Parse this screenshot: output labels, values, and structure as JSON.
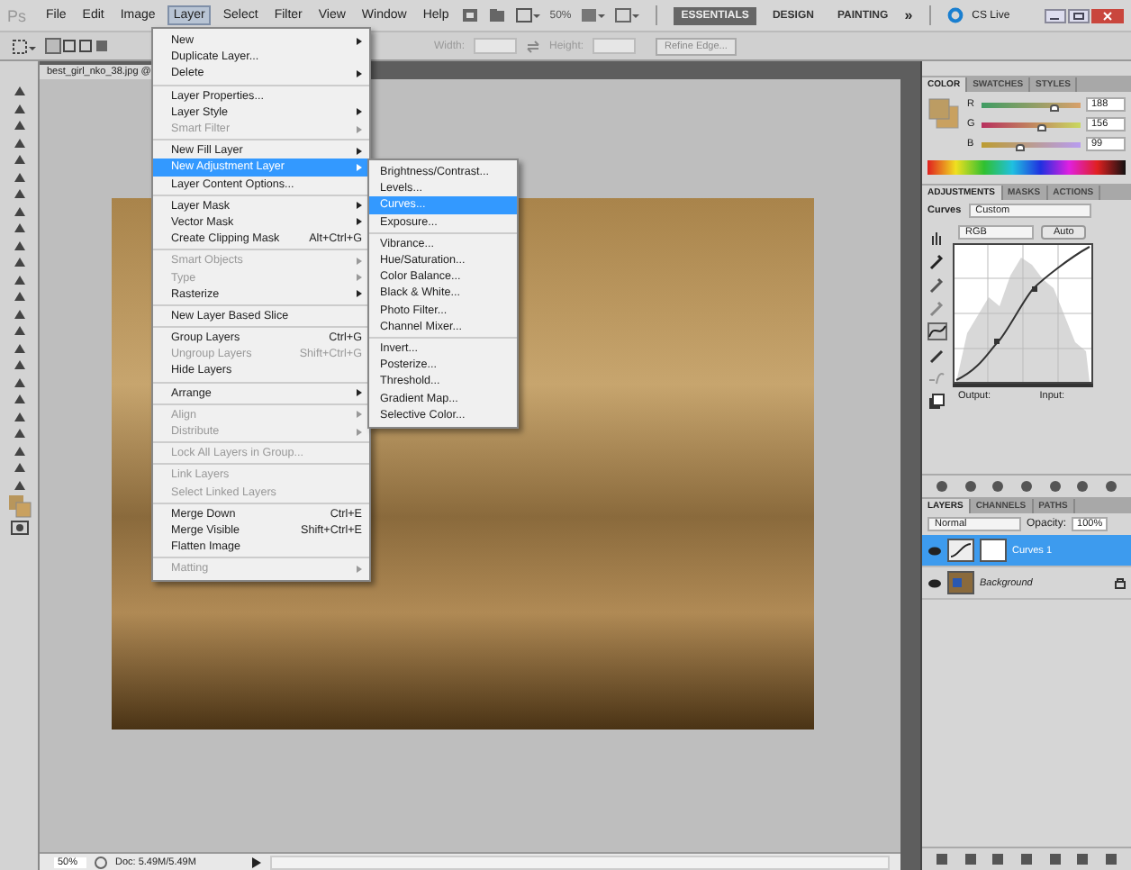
{
  "menu_bar": {
    "logo": "Ps",
    "items": [
      {
        "label": "File",
        "selected": false
      },
      {
        "label": "Edit",
        "selected": false
      },
      {
        "label": "Image",
        "selected": false
      },
      {
        "label": "Layer",
        "selected": true
      },
      {
        "label": "Select",
        "selected": false
      },
      {
        "label": "Filter",
        "selected": false
      },
      {
        "label": "View",
        "selected": false
      },
      {
        "label": "Window",
        "selected": false
      },
      {
        "label": "Help",
        "selected": false
      }
    ],
    "zoom": "50%",
    "workspaces": [
      {
        "label": "ESSENTIALS",
        "selected": true
      },
      {
        "label": "DESIGN",
        "selected": false
      },
      {
        "label": "PAINTING",
        "selected": false
      }
    ],
    "more": "»",
    "cs_live": "CS Live"
  },
  "options_bar": {
    "width_label": "Width:",
    "height_label": "Height:",
    "refine_button": "Refine Edge..."
  },
  "document_tab": {
    "title": "best_girl_nko_38.jpg @"
  },
  "layer_menu": {
    "groups": [
      [
        {
          "label": "New",
          "disabled": false,
          "submenu": true,
          "selected": false
        },
        {
          "label": "Duplicate Layer...",
          "disabled": false,
          "submenu": false,
          "selected": false
        },
        {
          "label": "Delete",
          "disabled": false,
          "submenu": true,
          "selected": false
        }
      ],
      [
        {
          "label": "Layer Properties...",
          "disabled": false,
          "submenu": false,
          "selected": false
        },
        {
          "label": "Layer Style",
          "disabled": false,
          "submenu": true,
          "selected": false
        },
        {
          "label": "Smart Filter",
          "disabled": true,
          "submenu": true,
          "selected": false
        }
      ],
      [
        {
          "label": "New Fill Layer",
          "disabled": false,
          "submenu": true,
          "selected": false
        },
        {
          "label": "New Adjustment Layer",
          "disabled": false,
          "submenu": true,
          "selected": true
        },
        {
          "label": "Layer Content Options...",
          "disabled": false,
          "submenu": false,
          "selected": false
        }
      ],
      [
        {
          "label": "Layer Mask",
          "disabled": false,
          "submenu": true,
          "selected": false
        },
        {
          "label": "Vector Mask",
          "disabled": false,
          "submenu": true,
          "selected": false
        },
        {
          "label": "Create Clipping Mask",
          "shortcut": "Alt+Ctrl+G",
          "disabled": false,
          "submenu": false,
          "selected": false
        }
      ],
      [
        {
          "label": "Smart Objects",
          "disabled": true,
          "submenu": true,
          "selected": false
        },
        {
          "label": "Type",
          "disabled": true,
          "submenu": true,
          "selected": false
        },
        {
          "label": "Rasterize",
          "disabled": false,
          "submenu": true,
          "selected": false
        }
      ],
      [
        {
          "label": "New Layer Based Slice",
          "disabled": false,
          "submenu": false,
          "selected": false
        }
      ],
      [
        {
          "label": "Group Layers",
          "shortcut": "Ctrl+G",
          "disabled": false,
          "submenu": false,
          "selected": false
        },
        {
          "label": "Ungroup Layers",
          "shortcut": "Shift+Ctrl+G",
          "disabled": true,
          "submenu": false,
          "selected": false
        },
        {
          "label": "Hide Layers",
          "disabled": false,
          "submenu": false,
          "selected": false
        }
      ],
      [
        {
          "label": "Arrange",
          "disabled": false,
          "submenu": true,
          "selected": false
        }
      ],
      [
        {
          "label": "Align",
          "disabled": true,
          "submenu": true,
          "selected": false
        },
        {
          "label": "Distribute",
          "disabled": true,
          "submenu": true,
          "selected": false
        }
      ],
      [
        {
          "label": "Lock All Layers in Group...",
          "disabled": true,
          "submenu": false,
          "selected": false
        }
      ],
      [
        {
          "label": "Link Layers",
          "disabled": true,
          "submenu": false,
          "selected": false
        },
        {
          "label": "Select Linked Layers",
          "disabled": true,
          "submenu": false,
          "selected": false
        }
      ],
      [
        {
          "label": "Merge Down",
          "shortcut": "Ctrl+E",
          "disabled": false,
          "submenu": false,
          "selected": false
        },
        {
          "label": "Merge Visible",
          "shortcut": "Shift+Ctrl+E",
          "disabled": false,
          "submenu": false,
          "selected": false
        },
        {
          "label": "Flatten Image",
          "disabled": false,
          "submenu": false,
          "selected": false
        }
      ],
      [
        {
          "label": "Matting",
          "disabled": true,
          "submenu": true,
          "selected": false
        }
      ]
    ]
  },
  "adjustment_submenu": {
    "groups": [
      [
        {
          "label": "Brightness/Contrast...",
          "selected": false
        },
        {
          "label": "Levels...",
          "selected": false
        },
        {
          "label": "Curves...",
          "selected": true
        },
        {
          "label": "Exposure...",
          "selected": false
        }
      ],
      [
        {
          "label": "Vibrance...",
          "selected": false
        },
        {
          "label": "Hue/Saturation...",
          "selected": false
        },
        {
          "label": "Color Balance...",
          "selected": false
        },
        {
          "label": "Black & White...",
          "selected": false
        },
        {
          "label": "Photo Filter...",
          "selected": false
        },
        {
          "label": "Channel Mixer...",
          "selected": false
        }
      ],
      [
        {
          "label": "Invert...",
          "selected": false
        },
        {
          "label": "Posterize...",
          "selected": false
        },
        {
          "label": "Threshold...",
          "selected": false
        },
        {
          "label": "Gradient Map...",
          "selected": false
        },
        {
          "label": "Selective Color...",
          "selected": false
        }
      ]
    ]
  },
  "color_panel": {
    "tabs": [
      {
        "label": "COLOR",
        "selected": true
      },
      {
        "label": "SWATCHES",
        "selected": false
      },
      {
        "label": "STYLES",
        "selected": false
      }
    ],
    "channels": [
      {
        "name": "R",
        "value": "188",
        "level": 0.74
      },
      {
        "name": "G",
        "value": "156",
        "level": 0.61
      },
      {
        "name": "B",
        "value": "99",
        "level": 0.39
      }
    ]
  },
  "adjustments_panel": {
    "tabs": [
      {
        "label": "ADJUSTMENTS",
        "selected": true
      },
      {
        "label": "MASKS",
        "selected": false
      },
      {
        "label": "ACTIONS",
        "selected": false
      }
    ],
    "title": "Curves",
    "preset": "Custom",
    "channel": "RGB",
    "auto_button": "Auto",
    "output_label": "Output:",
    "input_label": "Input:"
  },
  "layers_panel": {
    "tabs": [
      {
        "label": "LAYERS",
        "selected": true
      },
      {
        "label": "CHANNELS",
        "selected": false
      },
      {
        "label": "PATHS",
        "selected": false
      }
    ],
    "blend_mode": "Normal",
    "opacity_label": "Opacity:",
    "opacity": "100%",
    "layers": [
      {
        "name": "Curves 1",
        "kind": "adjustment",
        "selected": true,
        "visible": true,
        "locked": false
      },
      {
        "name": "Background",
        "kind": "image",
        "selected": false,
        "visible": true,
        "locked": true
      }
    ]
  },
  "status_bar": {
    "zoom": "50%",
    "doc_info": "Doc: 5.49M/5.49M"
  }
}
